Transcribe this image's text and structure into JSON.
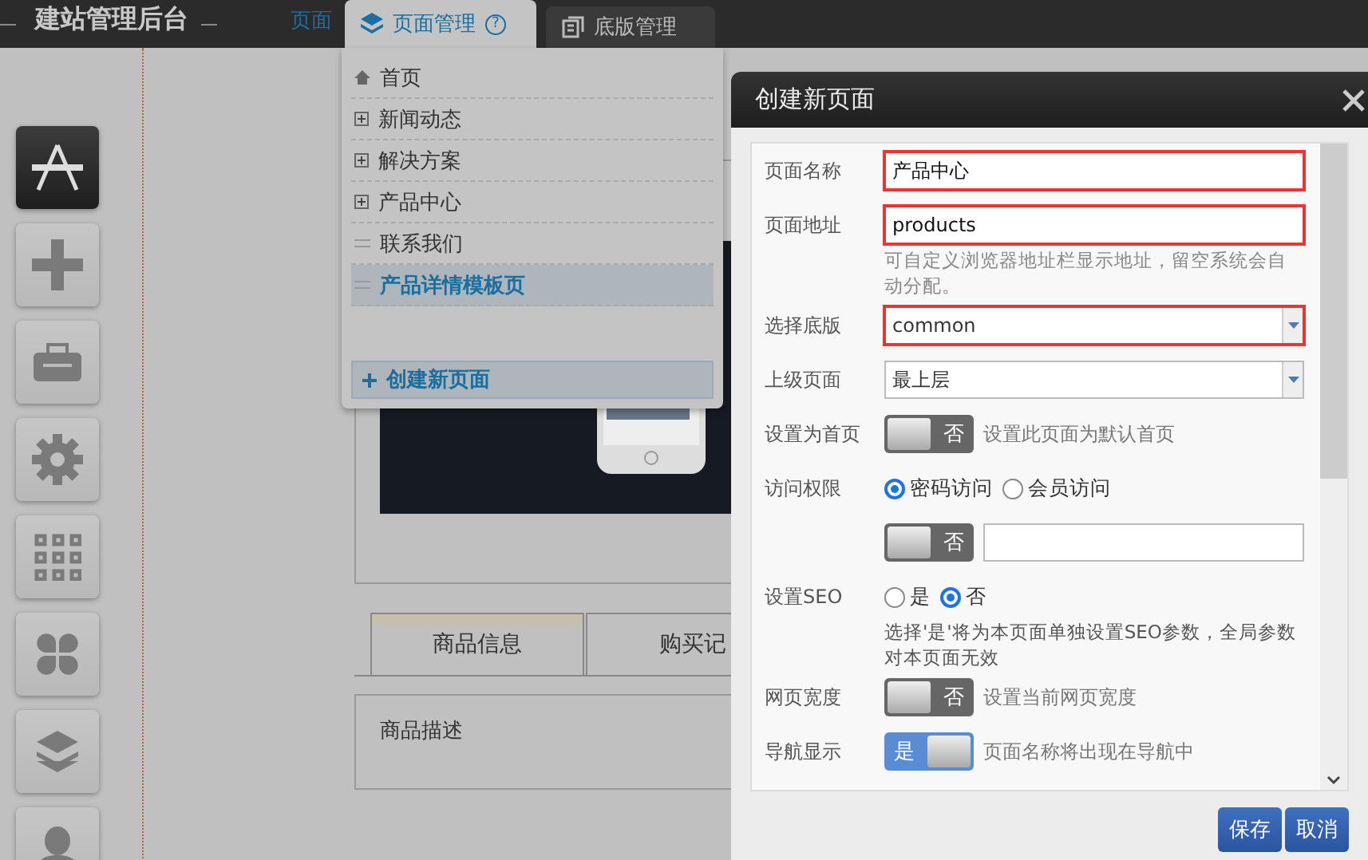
{
  "top_bar": {
    "title": "建站管理后台",
    "nav_link": "页面",
    "tabs": [
      {
        "label": "页面管理",
        "help": "?",
        "selected": true
      },
      {
        "label": "底版管理",
        "selected": false
      }
    ]
  },
  "tools": [
    {
      "kind": "design",
      "selected": true
    },
    {
      "kind": "add",
      "selected": false
    },
    {
      "kind": "toolbox",
      "selected": false
    },
    {
      "kind": "settings",
      "selected": false
    },
    {
      "kind": "grid",
      "selected": false
    },
    {
      "kind": "modules",
      "selected": false
    },
    {
      "kind": "layers",
      "selected": false
    },
    {
      "kind": "user",
      "selected": false
    }
  ],
  "page_menu": {
    "items": [
      {
        "label": "首页",
        "kind": "home",
        "selected": false
      },
      {
        "label": "新闻动态",
        "kind": "expandable",
        "selected": false
      },
      {
        "label": "解决方案",
        "kind": "expandable",
        "selected": false
      },
      {
        "label": "产品中心",
        "kind": "expandable",
        "selected": false
      },
      {
        "label": "联系我们",
        "kind": "leaf",
        "selected": false
      },
      {
        "label": "产品详情模板页",
        "kind": "leaf",
        "selected": true
      }
    ],
    "create_button": "创建新页面"
  },
  "canvas": {
    "tabs": [
      {
        "label": "商品信息",
        "selected": true
      },
      {
        "label": "购买记",
        "selected": false
      }
    ],
    "section_label": "商品描述"
  },
  "dialog": {
    "title": "创建新页面",
    "rows": [
      {
        "kind": "text",
        "label": "页面名称",
        "value": "产品中心",
        "highlighted": true
      },
      {
        "kind": "text",
        "label": "页面地址",
        "value": "products",
        "highlighted": true,
        "hint": "可自定义浏览器地址栏显示地址，留空系统会自动分配。"
      },
      {
        "kind": "select",
        "label": "选择底版",
        "value": "common",
        "highlighted": true
      },
      {
        "kind": "select",
        "label": "上级页面",
        "value": "最上层",
        "highlighted": false
      },
      {
        "kind": "toggle",
        "label": "设置为首页",
        "on": false,
        "toggle_text": "否",
        "description": "设置此页面为默认首页"
      },
      {
        "kind": "radio",
        "label": "访问权限",
        "options": [
          {
            "label": "密码访问",
            "selected": true
          },
          {
            "label": "会员访问",
            "selected": false
          }
        ]
      },
      {
        "kind": "toggle_input",
        "on": false,
        "toggle_text": "否"
      },
      {
        "kind": "radio",
        "label": "设置SEO",
        "options": [
          {
            "label": "是",
            "selected": false
          },
          {
            "label": "否",
            "selected": true
          }
        ],
        "hint": "选择'是'将为本页面单独设置SEO参数，全局参数对本页面无效"
      },
      {
        "kind": "toggle",
        "label": "网页宽度",
        "on": false,
        "toggle_text": "否",
        "description": "设置当前网页宽度"
      },
      {
        "kind": "toggle",
        "label": "导航显示",
        "on": true,
        "toggle_text": "是",
        "description": "页面名称将出现在导航中"
      }
    ],
    "buttons": [
      "保存",
      "取消"
    ]
  }
}
